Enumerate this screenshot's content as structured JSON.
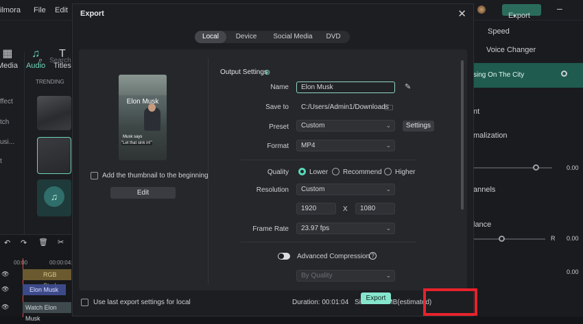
{
  "app": {
    "name_fragment": "ilmora",
    "menu": [
      "File",
      "Edit"
    ],
    "top_export_label": "Export",
    "left_tools": [
      {
        "label": "Media",
        "icon": "media-icon"
      },
      {
        "label": "Audio",
        "icon": "music-note-icon"
      },
      {
        "label": "Titles",
        "icon": "text-t-icon"
      }
    ],
    "left_labels": [
      "ffect",
      "tch",
      "usi...",
      "t"
    ],
    "trending_label": "TRENDING",
    "search_placeholder": "Search",
    "timeline": {
      "time_start": "00:00",
      "time_end": "00:00:04:1",
      "track1_label": "RGB Stroke",
      "track2_label": "Elon Musk",
      "track3_label": "Watch Elon Musk"
    },
    "right_panel": {
      "speed": "Speed",
      "voice_changer": "Voice Changer",
      "clip_name": "sing On The City",
      "nt": "nt",
      "normalization": "malization",
      "val1": "0.00",
      "channels": "annels",
      "balance": "lance",
      "r": "R",
      "val2": "0.00",
      "val3": "0.00"
    }
  },
  "dialog": {
    "title": "Export",
    "tabs": [
      {
        "label": "Local",
        "active": true
      },
      {
        "label": "Device",
        "active": false
      },
      {
        "label": "Social Media",
        "active": false
      },
      {
        "label": "DVD",
        "active": false
      }
    ],
    "preview": {
      "title": "Elon Musk",
      "caption1": "Musk says",
      "caption2": "\"Let that sink in!\""
    },
    "thumbnail_checkbox_label": "Add the thumbnail to the beginning",
    "edit_button": "Edit",
    "output_settings_label": "Output Settings",
    "fields": {
      "name_label": "Name",
      "name_value": "Elon Musk",
      "save_to_label": "Save to",
      "save_to_value": "C:/Users/Admin1/Downloads",
      "preset_label": "Preset",
      "preset_value": "Custom",
      "settings_button": "Settings",
      "format_label": "Format",
      "format_value": "MP4",
      "quality_label": "Quality",
      "quality_options": [
        "Lower",
        "Recommend",
        "Higher"
      ],
      "quality_selected": "Lower",
      "resolution_label": "Resolution",
      "resolution_value": "Custom",
      "width_value": "1920",
      "x_label": "X",
      "height_value": "1080",
      "frame_rate_label": "Frame Rate",
      "frame_rate_value": "23.97 fps",
      "advanced_compression_label": "Advanced Compression",
      "by_quality_value": "By Quality"
    },
    "footer": {
      "last_settings_label": "Use last export settings for local",
      "duration": "Duration: 00:01:04",
      "size": "Size: 5.28 MB(estimated)",
      "export_label": "Export"
    }
  },
  "colors": {
    "accent": "#86e6cd",
    "highlight_box": "#e8222c",
    "dialog_bg": "#1d1e22"
  }
}
